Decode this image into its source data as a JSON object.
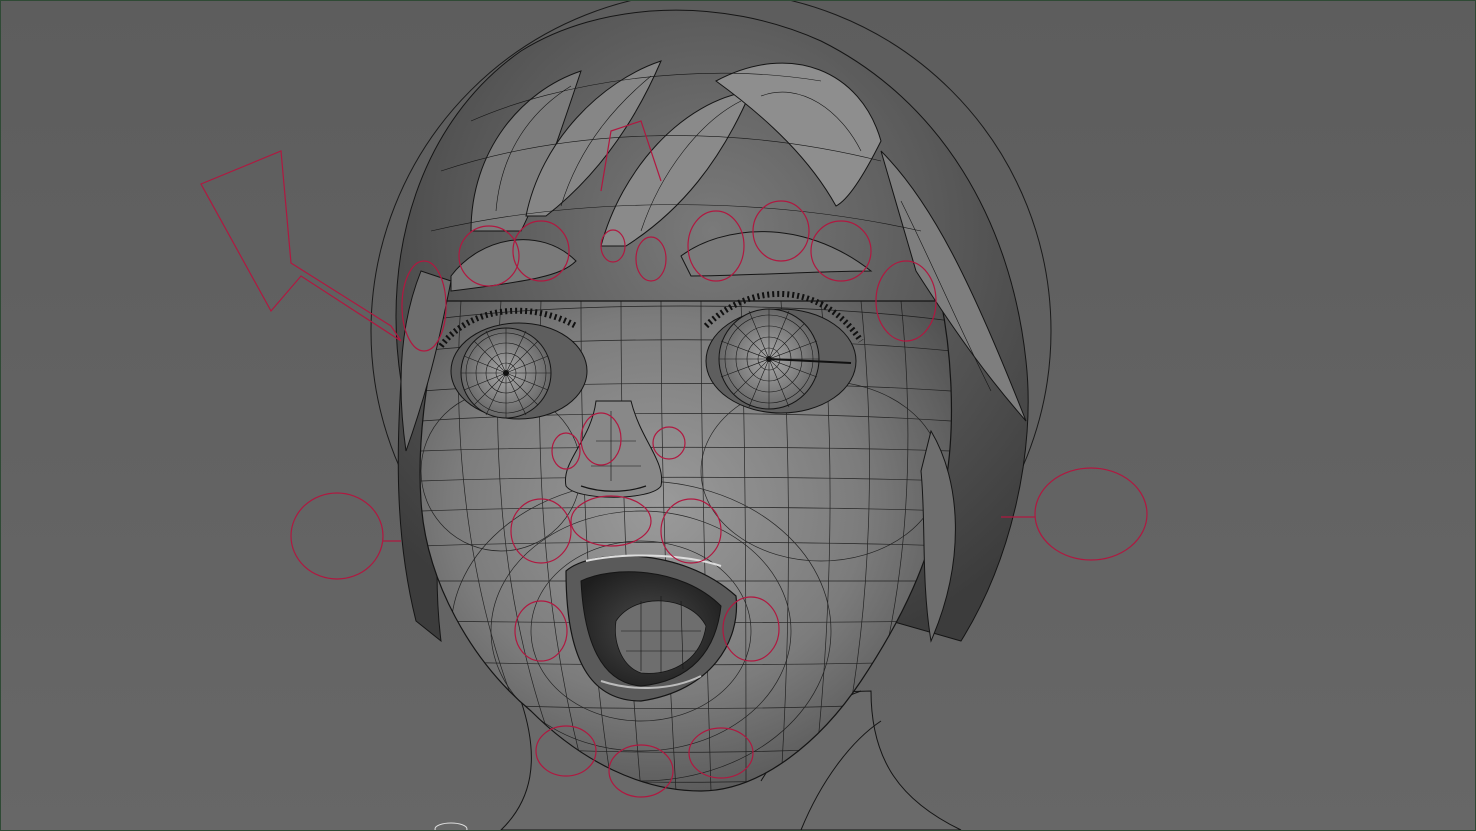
{
  "viewport": {
    "background_top": "#5d5d5d",
    "background_bottom": "#666666",
    "border_color": "#2f4a35"
  },
  "mesh": {
    "skin_light": "#8e8e8e",
    "skin_mid": "#6e6e6e",
    "skin_dark": "#3e3e3e",
    "wire_color": "#151515"
  },
  "rig": {
    "control_color": "#b01840",
    "icons": [
      "head-rotate-arrow",
      "jaw-circle-left",
      "jaw-circle-right",
      "brow-controls",
      "eye-controls",
      "nose-controls",
      "mouth-corner-controls",
      "chin-controls"
    ]
  }
}
